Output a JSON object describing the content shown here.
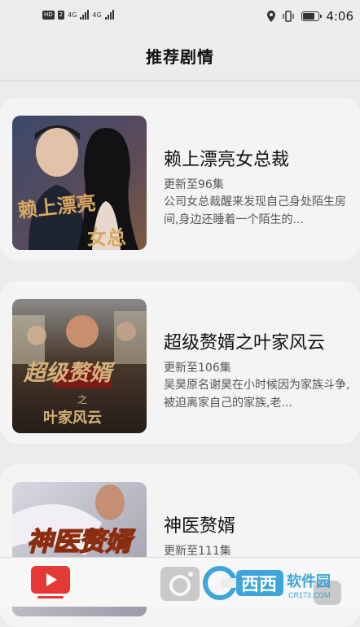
{
  "status_bar": {
    "hd_label": "HD",
    "sim_label": "2",
    "net1": "4G",
    "net2": "4G",
    "time": "4:06",
    "battery_level": 0.7,
    "icons": [
      "location-icon",
      "vibrate-icon",
      "battery-icon"
    ]
  },
  "header": {
    "title": "推荐剧情"
  },
  "dramas": [
    {
      "title": "赖上漂亮女总裁",
      "episodes": "更新至96集",
      "description": "公司女总裁醒来发现自己身处陌生房间,身边还睡着一个陌生的...",
      "cover_text": "赖上漂亮女总裁"
    },
    {
      "title": "超级赘婿之叶家风云",
      "episodes": "更新至106集",
      "description": "吴昊原名谢昊在小时候因为家族斗争,被迫离家自己的家族,老...",
      "cover_text": "超级赘婿之叶家风云"
    },
    {
      "title": "神医赘婿",
      "episodes": "更新至111集",
      "description": "",
      "cover_text": "神医赘婿"
    }
  ],
  "bottom_nav": {
    "items": [
      "video-tab-icon",
      "camera-tab-icon",
      "profile-tab-icon"
    ],
    "active_color": "#e53935"
  },
  "watermark": {
    "brand": "西西软件园",
    "site": "CR173.COM"
  }
}
